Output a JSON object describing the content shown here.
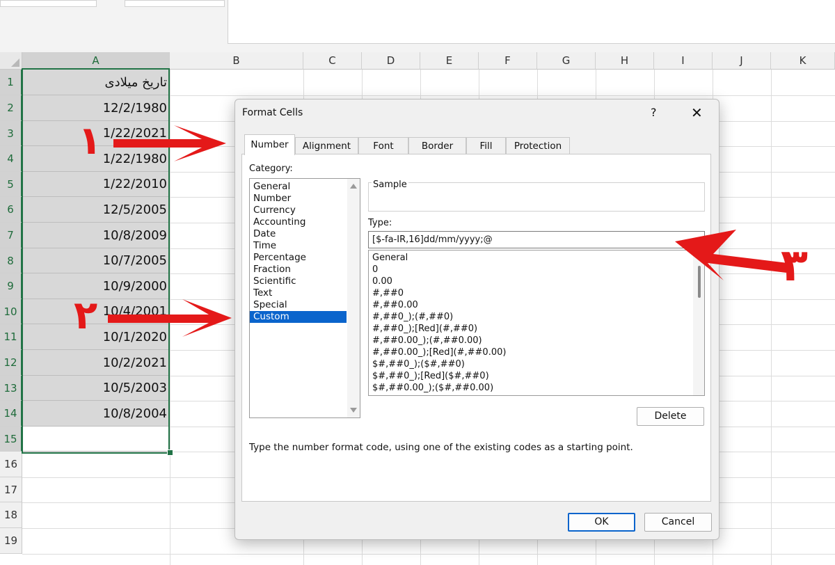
{
  "columns": [
    "A",
    "B",
    "C",
    "D",
    "E",
    "F",
    "G",
    "H",
    "I",
    "J",
    "K"
  ],
  "rows": [
    "1",
    "2",
    "3",
    "4",
    "5",
    "6",
    "7",
    "8",
    "9",
    "10",
    "11",
    "12",
    "13",
    "14",
    "15",
    "16",
    "17",
    "18",
    "19"
  ],
  "column_a_cells": [
    "تاریخ میلادی",
    "12/2/1980",
    "1/22/2021",
    "1/22/1980",
    "1/22/2010",
    "12/5/2005",
    "10/8/2009",
    "10/7/2005",
    "10/9/2000",
    "10/4/2001",
    "10/1/2020",
    "10/2/2021",
    "10/5/2003",
    "10/8/2004"
  ],
  "dialog": {
    "title": "Format Cells",
    "help": "?",
    "close": "✕",
    "tabs": [
      "Number",
      "Alignment",
      "Font",
      "Border",
      "Fill",
      "Protection"
    ],
    "category_label": "Category:",
    "categories": [
      "General",
      "Number",
      "Currency",
      "Accounting",
      "Date",
      "Time",
      "Percentage",
      "Fraction",
      "Scientific",
      "Text",
      "Special",
      "Custom"
    ],
    "selected_category": "Custom",
    "sample_label": "Sample",
    "type_label": "Type:",
    "type_value": "[$-fa-IR,16]dd/mm/yyyy;@",
    "format_codes": [
      "General",
      "0",
      "0.00",
      "#,##0",
      "#,##0.00",
      "#,##0_);(#,##0)",
      "#,##0_);[Red](#,##0)",
      "#,##0.00_);(#,##0.00)",
      "#,##0.00_);[Red](#,##0.00)",
      "$#,##0_);($#,##0)",
      "$#,##0_);[Red]($#,##0)",
      "$#,##0.00_);($#,##0.00)"
    ],
    "delete_label": "Delete",
    "hint": "Type the number format code, using one of the existing codes as a starting point.",
    "ok_label": "OK",
    "cancel_label": "Cancel"
  },
  "annotations": {
    "step1": "۱",
    "step2": "۲",
    "step3": "۳",
    "color": "#e41919"
  }
}
